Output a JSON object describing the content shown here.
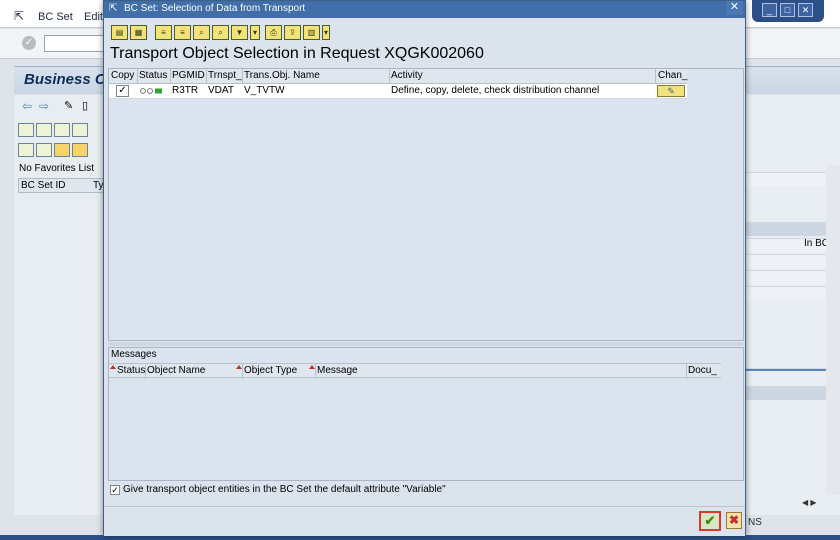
{
  "background": {
    "menu": [
      "BC Set",
      "Edit"
    ],
    "title_fragment": "Business C",
    "no_favorites": "No Favorites List",
    "col_id": "BC Set ID",
    "col_type": "Ty",
    "right_col": "In BC",
    "status_fragment": "NS"
  },
  "dialog": {
    "title": "BC Set: Selection of Data from Transport",
    "heading": "Transport Object Selection in Request XQGK002060",
    "columns": [
      "Copy",
      "Status",
      "PGMID",
      "Trnspt_",
      "Trans.Obj. Name",
      "Activity",
      "Chan_"
    ],
    "rows": [
      {
        "copy": "✓",
        "pgmid": "R3TR",
        "trnspt": "VDAT",
        "obj_name": "V_TVTW",
        "activity": "Define, copy, delete, check distribution channel"
      }
    ],
    "messages_label": "Messages",
    "msg_columns": [
      "Status",
      "Object Name",
      "Object Type",
      "Message",
      "Docu_"
    ],
    "variable_check": "✓",
    "variable_text": "Give transport object entities in the BC Set the default attribute \"Variable\"",
    "ok": "✔",
    "cancel": "✖"
  },
  "colors": {
    "titlebar": "#3f6ea8",
    "ok_highlight": "#e0352f",
    "accent": "#2d4f87"
  }
}
